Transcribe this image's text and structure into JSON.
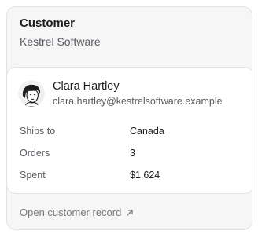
{
  "card": {
    "title": "Customer",
    "subtitle": "Kestrel Software"
  },
  "customer": {
    "name": "Clara Hartley",
    "email": "clara.hartley@kestrelsoftware.example"
  },
  "details": [
    {
      "label": "Ships to",
      "value": "Canada"
    },
    {
      "label": "Orders",
      "value": "3"
    },
    {
      "label": "Spent",
      "value": "$1,624"
    }
  ],
  "footer": {
    "link_label": "Open customer record",
    "icon": "arrow-up-right-icon"
  },
  "colors": {
    "card_bg": "#f6f6f7",
    "inner_bg": "#ffffff",
    "border": "#e3e3e6",
    "text_primary": "#1d1d1f",
    "text_secondary": "#5a5a60",
    "link": "#7a7a80"
  }
}
